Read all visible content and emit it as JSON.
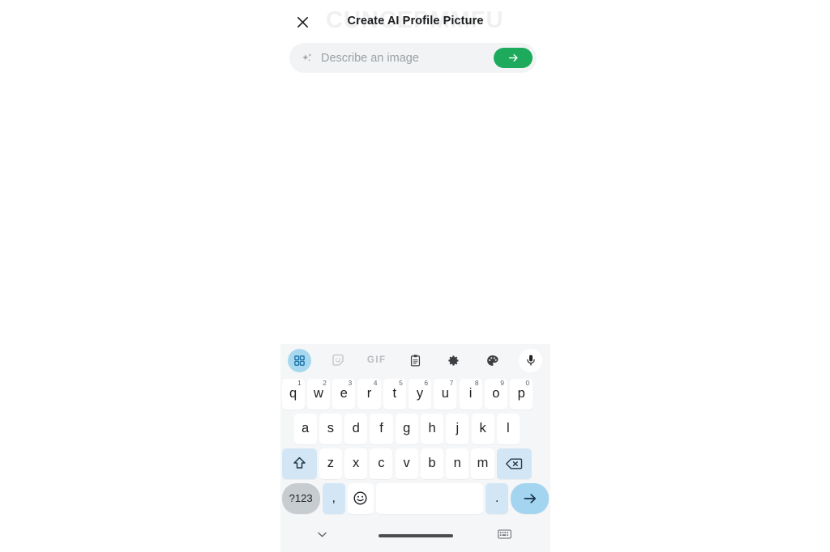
{
  "header": {
    "title": "Create AI Profile Picture",
    "close_icon": "close-icon",
    "watermark_text": "CUNCEPMMFU"
  },
  "prompt": {
    "placeholder": "Describe an image",
    "value": "",
    "leading_icon": "sparkle-icon",
    "send_icon": "arrow-right-icon",
    "send_color": "#1eaa5c"
  },
  "keyboard": {
    "toolbar": [
      {
        "name": "apps-grid-icon",
        "label": "",
        "state": "active"
      },
      {
        "name": "sticker-icon",
        "label": "",
        "state": "normal"
      },
      {
        "name": "gif-icon",
        "label": "GIF",
        "state": "normal"
      },
      {
        "name": "clipboard-icon",
        "label": "",
        "state": "normal"
      },
      {
        "name": "gear-icon",
        "label": "",
        "state": "normal"
      },
      {
        "name": "palette-icon",
        "label": "",
        "state": "normal"
      },
      {
        "name": "microphone-icon",
        "label": "",
        "state": "white"
      }
    ],
    "row1": [
      {
        "key": "q",
        "sup": "1"
      },
      {
        "key": "w",
        "sup": "2"
      },
      {
        "key": "e",
        "sup": "3"
      },
      {
        "key": "r",
        "sup": "4"
      },
      {
        "key": "t",
        "sup": "5"
      },
      {
        "key": "y",
        "sup": "6"
      },
      {
        "key": "u",
        "sup": "7"
      },
      {
        "key": "i",
        "sup": "8"
      },
      {
        "key": "o",
        "sup": "9"
      },
      {
        "key": "p",
        "sup": "0"
      }
    ],
    "row2": [
      {
        "key": "a"
      },
      {
        "key": "s"
      },
      {
        "key": "d"
      },
      {
        "key": "f"
      },
      {
        "key": "g"
      },
      {
        "key": "h"
      },
      {
        "key": "j"
      },
      {
        "key": "k"
      },
      {
        "key": "l"
      }
    ],
    "row3": {
      "shift_icon": "shift-up-arrow-icon",
      "letters": [
        {
          "key": "z"
        },
        {
          "key": "x"
        },
        {
          "key": "c"
        },
        {
          "key": "v"
        },
        {
          "key": "b"
        },
        {
          "key": "n"
        },
        {
          "key": "m"
        }
      ],
      "backspace_icon": "backspace-icon"
    },
    "row4": {
      "symbols_label": "?123",
      "comma": ",",
      "emoji_icon": "emoji-smiley-icon",
      "space": "",
      "period": ".",
      "enter_icon": "enter-arrow-icon",
      "enter_color": "#a3d4f0"
    }
  },
  "nav": {
    "hide_keyboard_icon": "chevron-down-icon",
    "home_indicator": "home-gesture-bar",
    "keyboard_switcher_icon": "keyboard-switcher-icon"
  }
}
